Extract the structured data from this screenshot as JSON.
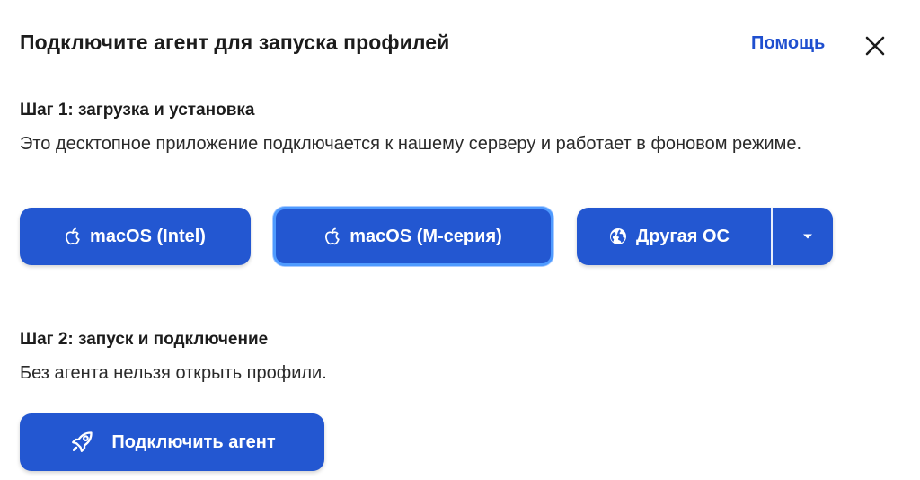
{
  "dialog": {
    "title": "Подключите агент для запуска профилей",
    "help_label": "Помощь"
  },
  "step1": {
    "title": "Шаг 1: загрузка и установка",
    "description": "Это десктопное приложение подключается к нашему серверу и работает в фоновом режиме.",
    "buttons": {
      "macos_intel": "macOS (Intel)",
      "macos_m": "macOS (M-серия)",
      "other_os": "Другая ОС"
    }
  },
  "step2": {
    "title": "Шаг 2: запуск и подключение",
    "description": "Без агента нельзя открыть профили.",
    "connect_button": "Подключить агент"
  },
  "icons": {
    "close": "close-icon",
    "apple": "apple-icon",
    "globe": "globe-icon",
    "caret": "chevron-down-icon",
    "rocket": "rocket-icon"
  },
  "colors": {
    "primary": "#2357d1",
    "link": "#1f4fcf",
    "focus_ring": "#4f9bff"
  }
}
